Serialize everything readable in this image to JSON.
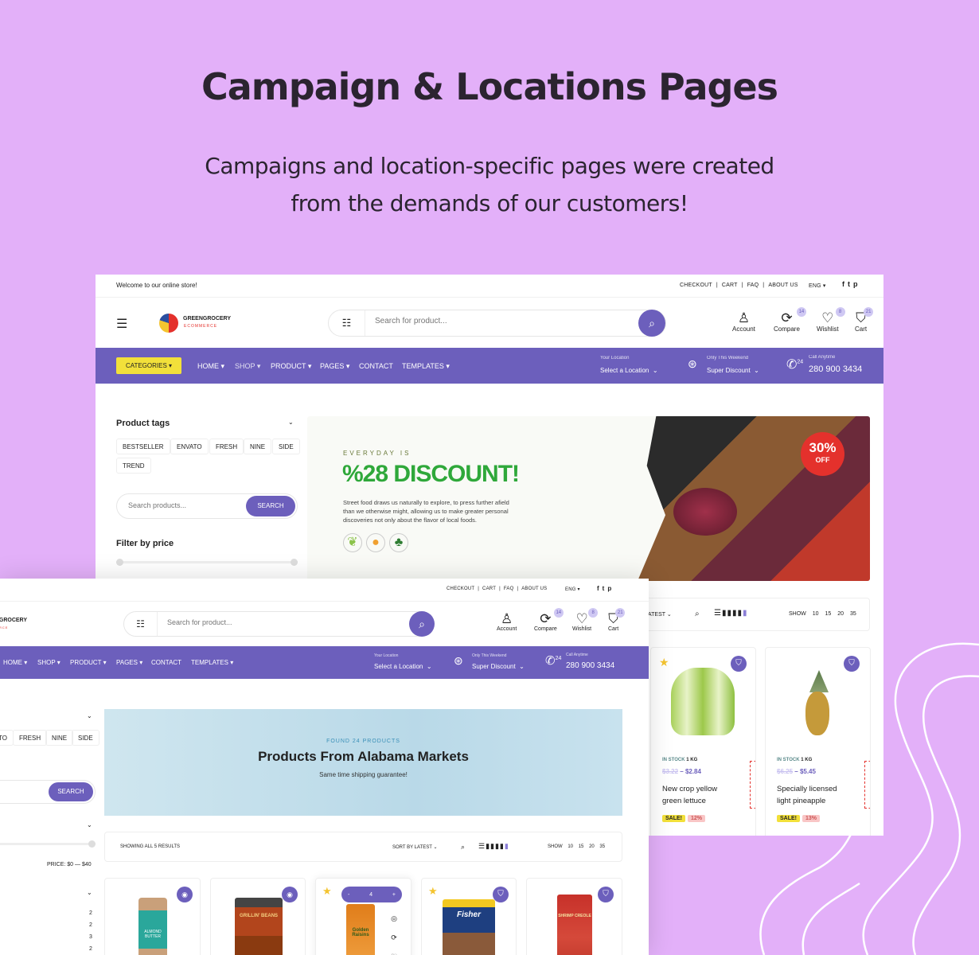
{
  "hero": {
    "title": "Campaign & Locations Pages",
    "subtitle_1": "Campaigns and location-specific pages were created",
    "subtitle_2": "from the demands of our customers!"
  },
  "colors": {
    "background": "#e3b0f9",
    "brand": "#6c5fbc",
    "categories": "#f2e03a",
    "discount_green": "#2fa83a",
    "sale_yellow": "#f2e03a",
    "pct_pink": "#f9c6c6",
    "off_red": "#e4312c"
  },
  "topbar": {
    "welcome": "Welcome to our online store!",
    "links": [
      "CHECKOUT",
      "CART",
      "FAQ",
      "ABOUT US"
    ],
    "language": "ENG",
    "social": [
      "facebook-icon",
      "twitter-icon",
      "pinterest-icon"
    ]
  },
  "header": {
    "logo_name": "GREENGROCERY",
    "logo_sub": "ECOMMERCE",
    "search_placeholder": "Search for product...",
    "account": "Account",
    "compare": "Compare",
    "compare_count": "14",
    "wishlist": "Wishlist",
    "wishlist_count": "8",
    "cart": "Cart",
    "cart_count": "21"
  },
  "nav": {
    "categories": "CATEGORIES",
    "items": [
      "HOME",
      "SHOP",
      "PRODUCT",
      "PAGES",
      "CONTACT",
      "TEMPLATES"
    ],
    "location_label": "Your Location",
    "location_value": "Select a Location",
    "weekend_label": "Only This Weekend",
    "weekend_value": "Super Discount",
    "call_label": "Call Anytime",
    "call_badge": "24",
    "phone": "280 900 3434"
  },
  "back_sidebar": {
    "product_tags_title": "Product tags",
    "tags": [
      "BESTSELLER",
      "ENVATO",
      "FRESH",
      "NINE",
      "SIDE",
      "TREND"
    ],
    "search_placeholder": "Search products...",
    "search_button": "SEARCH",
    "filter_title": "Filter by price"
  },
  "campaign_banner": {
    "kicker": "EVERYDAY IS",
    "headline": "%28 DISCOUNT!",
    "body_1": "Street food draws us naturally to explore, to press further afield",
    "body_2": "than we otherwise might, allowing us to make greater personal",
    "body_3": "discoveries not only about the flavor of local foods.",
    "badge_pct": "30%",
    "badge_off": "OFF"
  },
  "toolbar": {
    "results": "SHOWING ALL 5 RESULTS",
    "sort": "SORT BY LATEST",
    "sort_partial": "ATEST",
    "show": "SHOW",
    "counts": [
      "10",
      "15",
      "20",
      "35"
    ]
  },
  "back_products": [
    {
      "stock": "IN STOCK",
      "weight": "1 KG",
      "old_price": "$3.22",
      "price": "$2.84",
      "name_1": "New crop yellow",
      "name_2": "green lettuce",
      "sale": "SALE!",
      "pct": "12%",
      "discount": "DISCOUNT 20%"
    },
    {
      "stock": "IN STOCK",
      "weight": "1 KG",
      "old_price": "$6.25",
      "price": "$5.45",
      "name_1": "Specially licensed",
      "name_2": "light pineapple",
      "sale": "SALE!",
      "pct": "13%",
      "discount": "DISCOUNT 20%"
    }
  ],
  "location_banner": {
    "kicker": "FOUND 24 PRODUCTS",
    "title": "Products From Alabama Markets",
    "subtitle": "Same time shipping guarantee!"
  },
  "front_sidebar": {
    "tags": [
      "TO",
      "FRESH",
      "NINE",
      "SIDE"
    ],
    "search_button": "SEARCH",
    "price": "PRICE: $0 — $40",
    "counts": [
      "2",
      "2",
      "3",
      "2"
    ]
  },
  "front_products": {
    "qty": "4",
    "minus": "-",
    "plus": "+",
    "labels": [
      "ALMOND BUTTER",
      "GRILLIN' BEANS",
      "Golden Raisins",
      "Fisher",
      "SHRIMP CREOLE"
    ]
  }
}
